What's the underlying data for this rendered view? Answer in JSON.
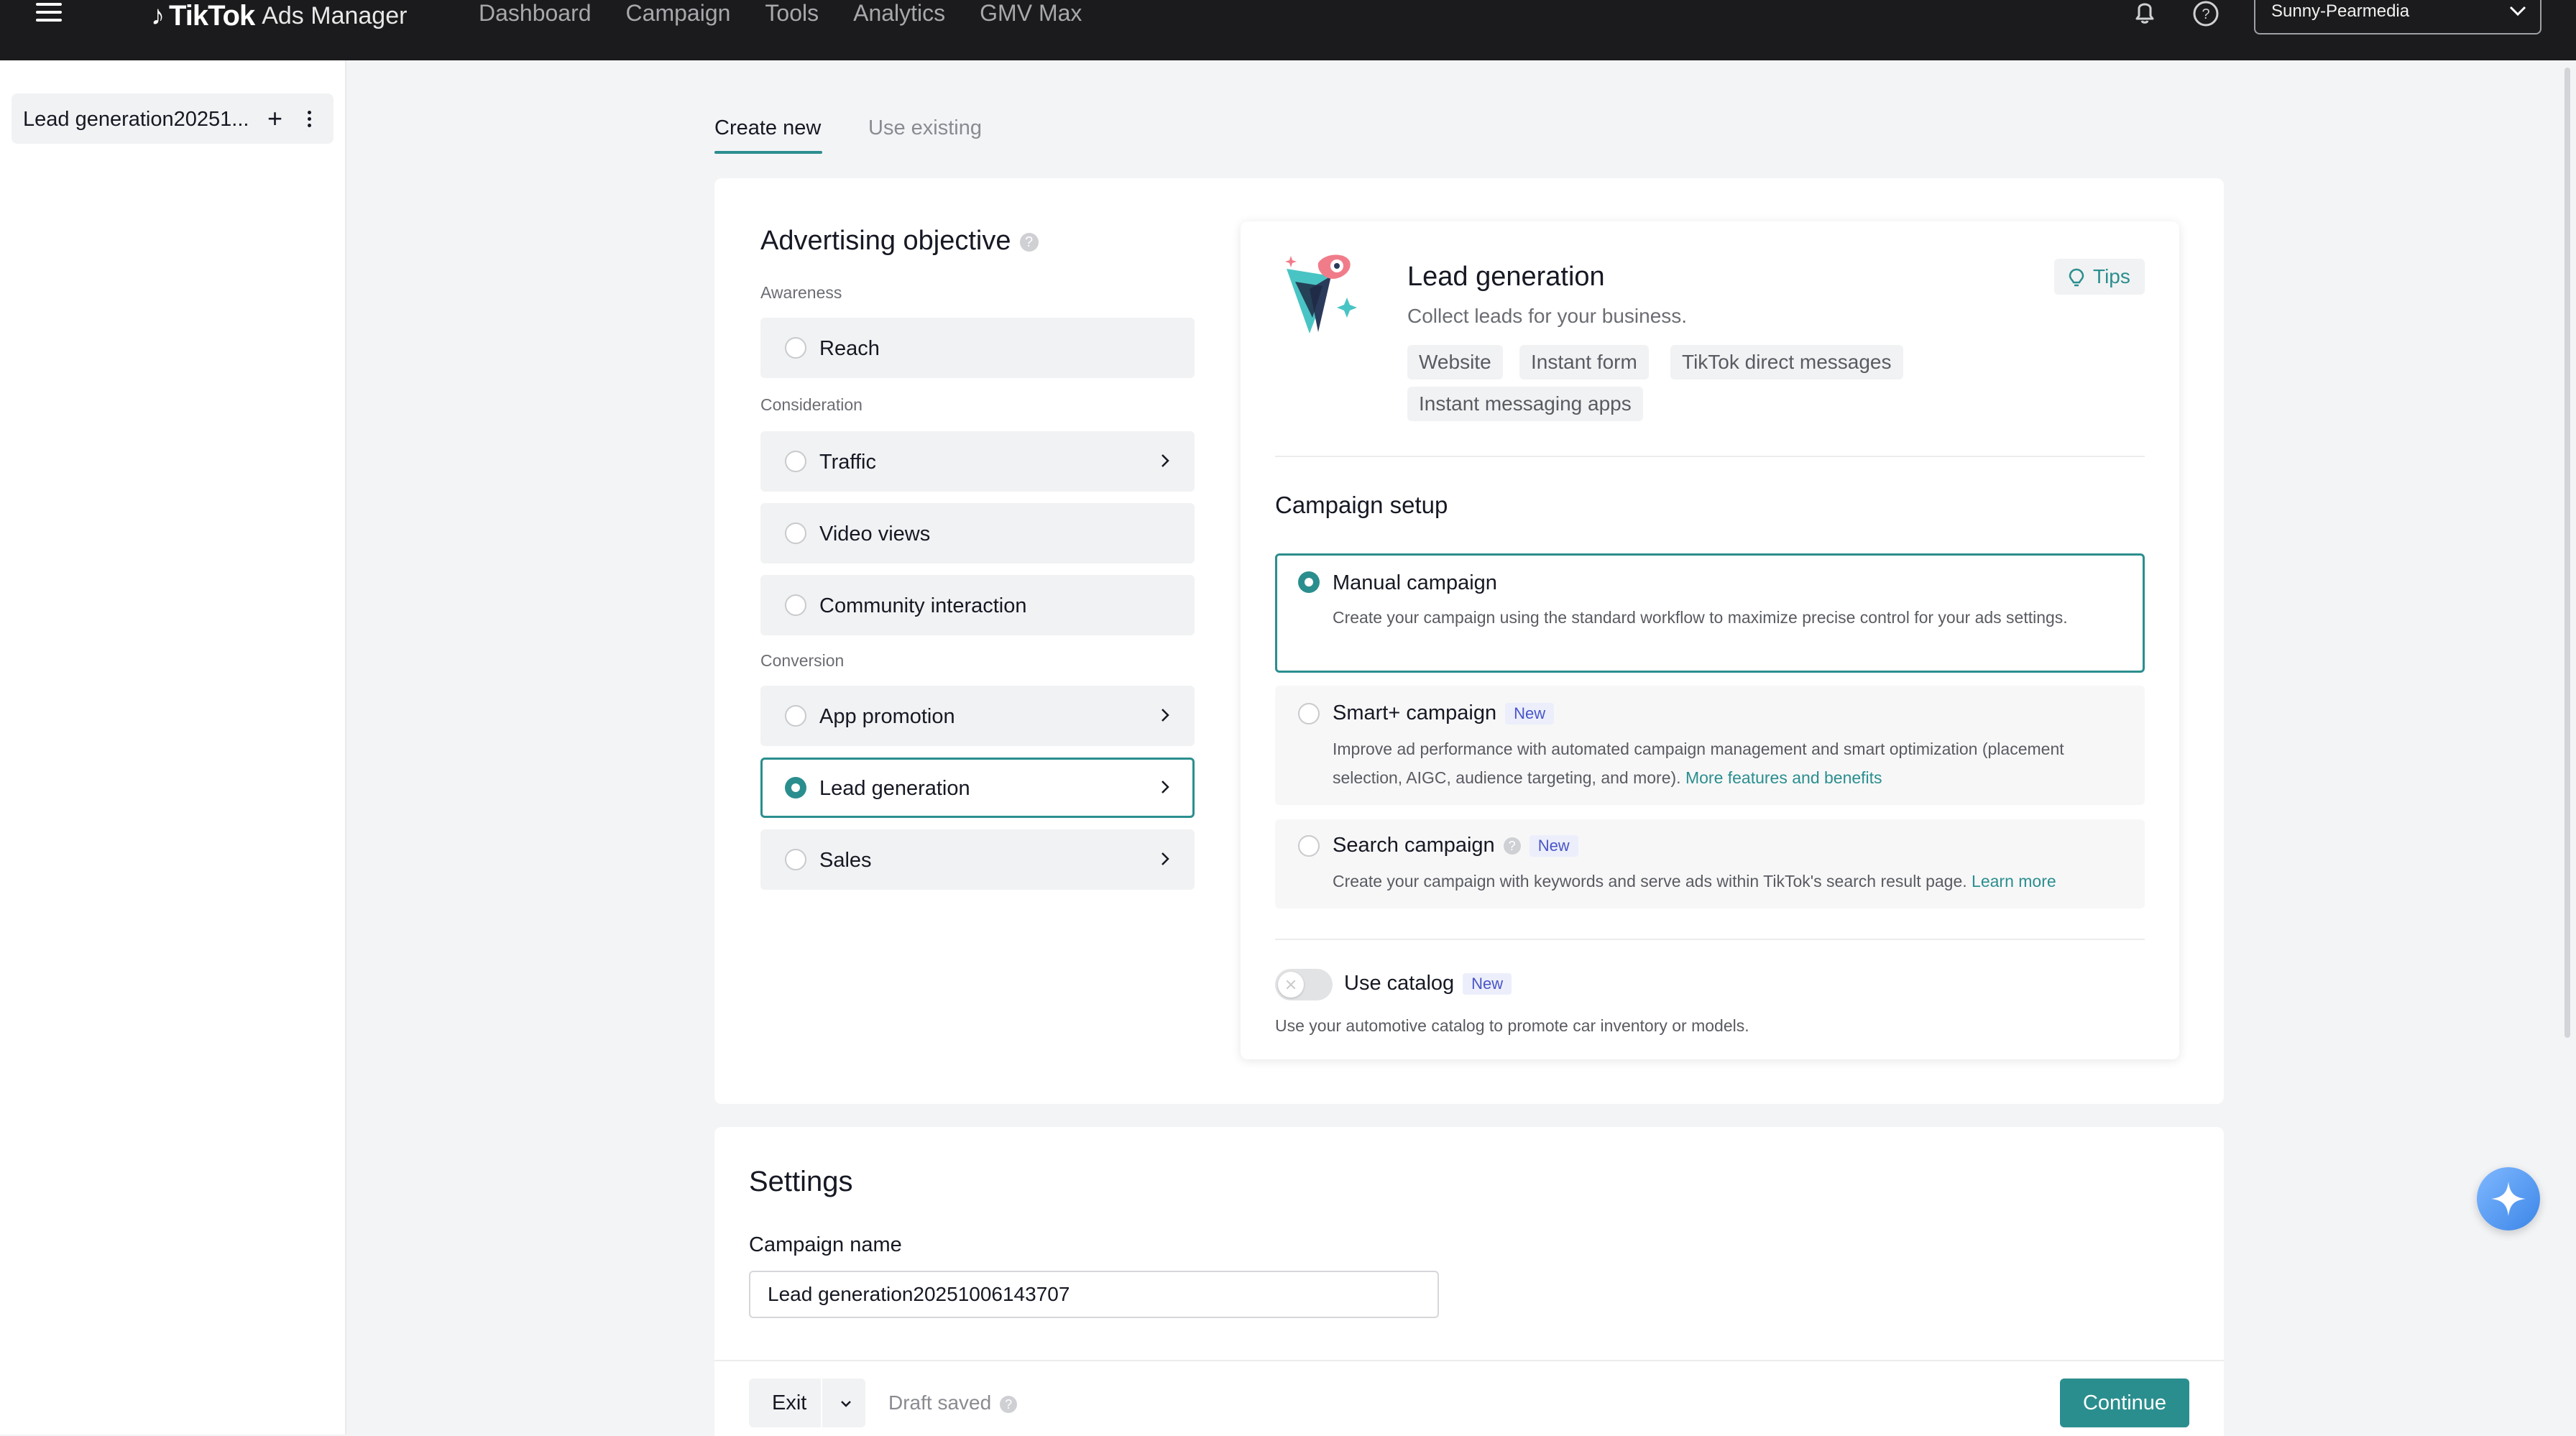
{
  "header": {
    "logo_brand": "TikTok",
    "logo_sub": "Ads Manager",
    "nav": [
      "Dashboard",
      "Campaign",
      "Tools",
      "Analytics",
      "GMV Max"
    ],
    "account": "Sunny-Pearmedia"
  },
  "sidebar": {
    "campaign_item": "Lead generation20251..."
  },
  "tabs": {
    "create_new": "Create new",
    "use_existing": "Use existing"
  },
  "objective": {
    "title": "Advertising objective",
    "groups": {
      "awareness": "Awareness",
      "consideration": "Consideration",
      "conversion": "Conversion"
    },
    "options": {
      "reach": "Reach",
      "traffic": "Traffic",
      "video_views": "Video views",
      "community": "Community interaction",
      "app_promotion": "App promotion",
      "lead_generation": "Lead generation",
      "sales": "Sales"
    },
    "selected": "Lead generation"
  },
  "info": {
    "title": "Lead generation",
    "description": "Collect leads for your business.",
    "tips": "Tips",
    "chips": [
      "Website",
      "Instant form",
      "TikTok direct messages",
      "Instant messaging apps"
    ]
  },
  "campaign_setup": {
    "title": "Campaign setup",
    "manual": {
      "title": "Manual campaign",
      "desc": "Create your campaign using the standard workflow to maximize precise control for your ads settings."
    },
    "smart": {
      "title": "Smart+ campaign",
      "badge": "New",
      "desc": "Improve ad performance with automated campaign management and smart optimization (placement selection, AIGC, audience targeting, and more).",
      "link": "More features and benefits"
    },
    "search": {
      "title": "Search campaign",
      "badge": "New",
      "desc": "Create your campaign with keywords and serve ads within TikTok's search result page.",
      "link": "Learn more"
    },
    "catalog": {
      "label": "Use catalog",
      "badge": "New",
      "desc": "Use your automotive catalog to promote car inventory or models."
    }
  },
  "settings": {
    "title": "Settings",
    "campaign_name_label": "Campaign name",
    "campaign_name_value": "Lead generation20251006143707"
  },
  "footer": {
    "exit": "Exit",
    "draft": "Draft saved",
    "continue": "Continue"
  },
  "colors": {
    "accent": "#2b8e8e",
    "topbar": "#1b1b1d"
  }
}
